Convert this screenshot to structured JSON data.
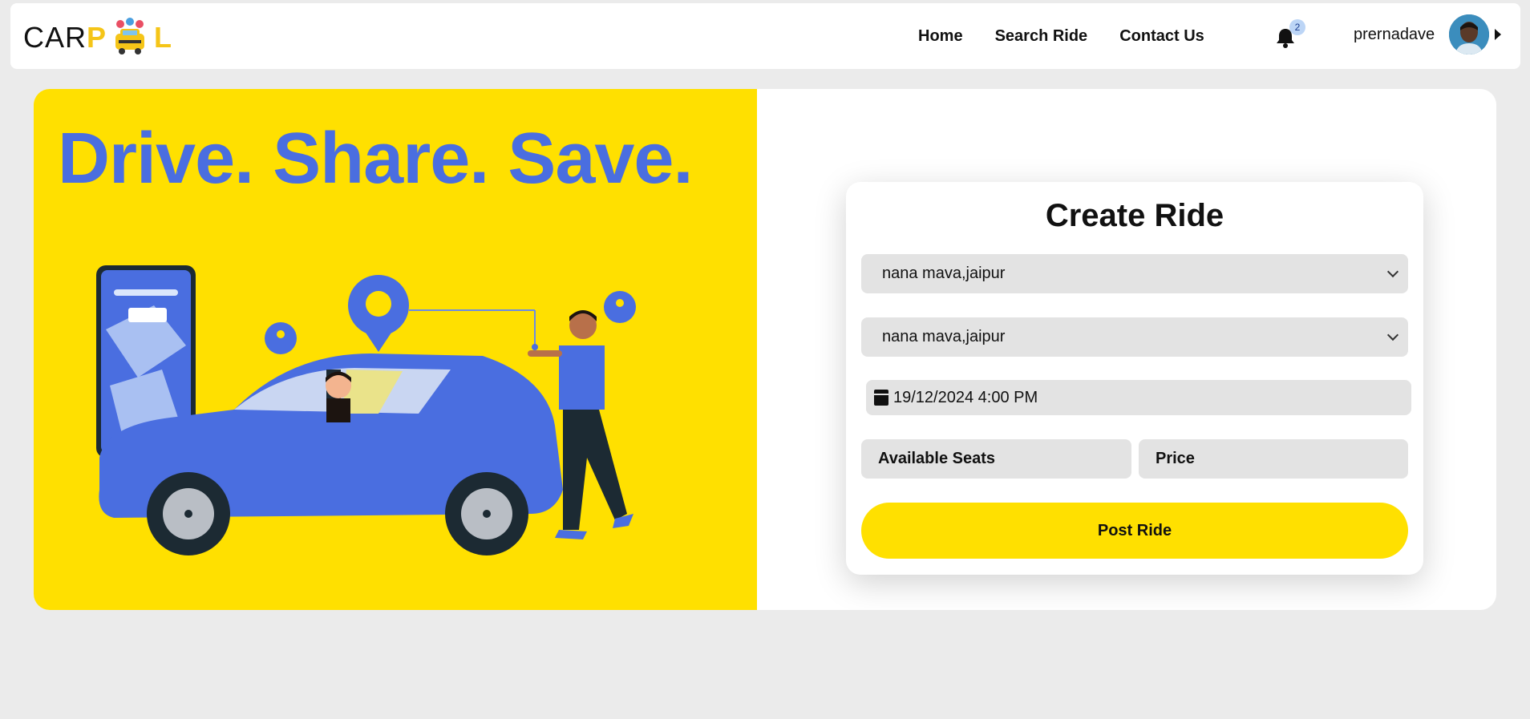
{
  "app": {
    "logo_prefix": "CAR",
    "logo_p": "P",
    "logo_l": "L"
  },
  "nav": {
    "links": [
      {
        "label": "Home"
      },
      {
        "label": "Search Ride"
      },
      {
        "label": "Contact Us"
      }
    ],
    "notification_count": "2",
    "username": "prernadave"
  },
  "hero": {
    "tagline": "Drive. Share. Save."
  },
  "form": {
    "title": "Create Ride",
    "from_location": "nana mava,jaipur",
    "to_location": "nana mava,jaipur",
    "datetime": "19/12/2024 4:00 PM",
    "seats_placeholder": "Available Seats",
    "price_placeholder": "Price",
    "submit_label": "Post Ride"
  },
  "colors": {
    "accent_yellow": "#ffe000",
    "brand_blue": "#4a6ee0",
    "background": "#ebebeb"
  },
  "icons": [
    "carpool-logo-icon",
    "bell-icon",
    "calendar-icon",
    "chevron-down-icon",
    "caret-right-icon"
  ]
}
